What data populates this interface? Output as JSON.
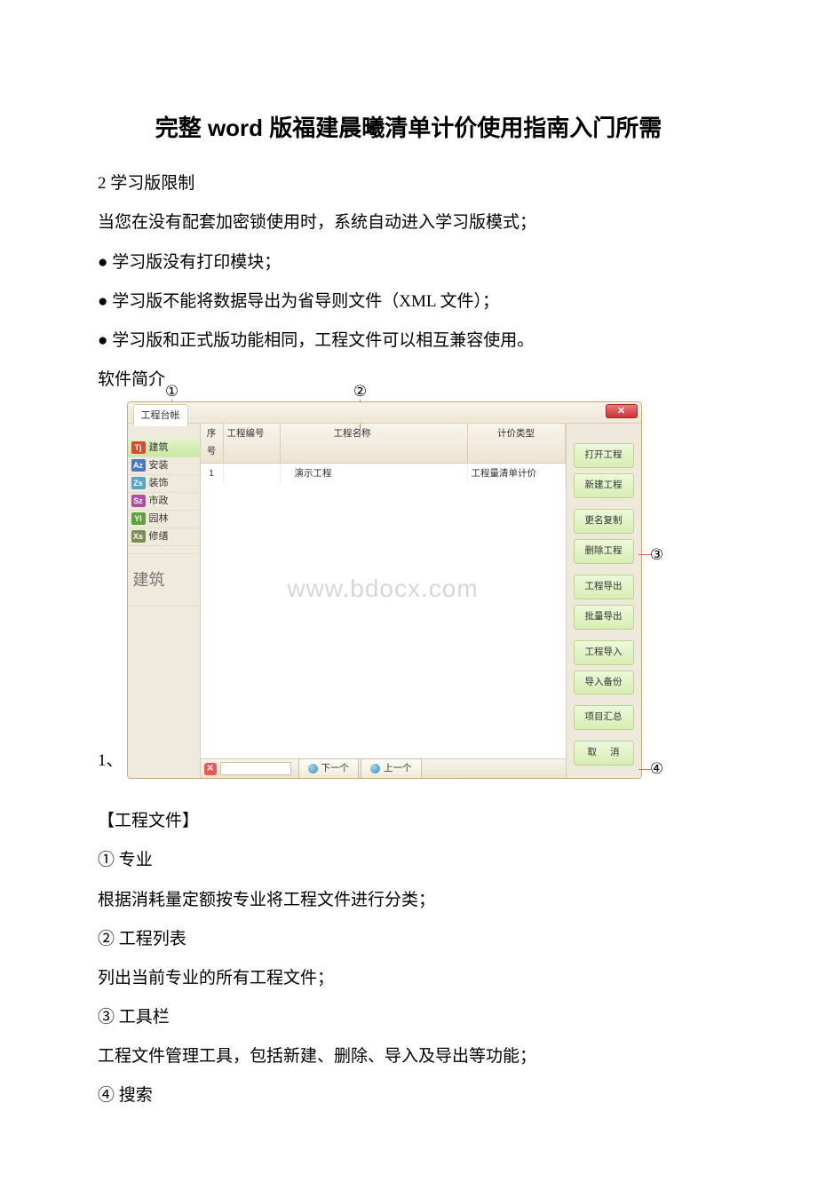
{
  "title": "完整 word 版福建晨曦清单计价使用指南入门所需",
  "paras": {
    "p1": "2 学习版限制",
    "p2": "当您在没有配套加密锁使用时，系统自动进入学习版模式；",
    "p3": "● 学习版没有打印模块；",
    "p4": "● 学习版不能将数据导出为省导则文件（XML 文件）；",
    "p5": "● 学习版和正式版功能相同，工程文件可以相互兼容使用。",
    "p6": "软件简介"
  },
  "markers": {
    "m1": "①",
    "m2": "②",
    "m3": "③",
    "m4": "④"
  },
  "figure_index": "1、",
  "window": {
    "tab_title": "工程台帐",
    "close_glyph": "✕",
    "sidebar": {
      "items": [
        {
          "code": "Tj",
          "color": "#d84b2e",
          "label": "建筑",
          "active": true
        },
        {
          "code": "Az",
          "color": "#4a77c4",
          "label": "安装",
          "active": false
        },
        {
          "code": "Zs",
          "color": "#5aa3c4",
          "label": "装饰",
          "active": false
        },
        {
          "code": "Sz",
          "color": "#b04fa0",
          "label": "市政",
          "active": false
        },
        {
          "code": "Yl",
          "color": "#5aa63a",
          "label": "园林",
          "active": false
        },
        {
          "code": "Xs",
          "color": "#7d8f57",
          "label": "修缮",
          "active": false
        }
      ],
      "big_label": "建筑"
    },
    "grid": {
      "headers": {
        "seq": "序号",
        "num": "工程编号",
        "name": "工程名称",
        "type": "计价类型"
      },
      "row": {
        "seq": "1",
        "num": "",
        "name": "演示工程",
        "type": "工程量清单计价"
      }
    },
    "watermark": "www.bdocx.com",
    "footer": {
      "delete_glyph": "✕",
      "next": "下一个",
      "prev": "上一个"
    },
    "toolbar": {
      "b1": "打开工程",
      "b2": "新建工程",
      "b3": "更名复制",
      "b4": "删除工程",
      "b5": "工程导出",
      "b6": "批量导出",
      "b7": "工程导入",
      "b8": "导入备份",
      "b9": "项目汇总",
      "b10": "取 消"
    }
  },
  "after": {
    "a1": "【工程文件】",
    "a2": "① 专业",
    "a3": "根据消耗量定额按专业将工程文件进行分类；",
    "a4": "② 工程列表",
    "a5": "列出当前专业的所有工程文件；",
    "a6": "③ 工具栏",
    "a7": "工程文件管理工具，包括新建、删除、导入及导出等功能；",
    "a8": "④ 搜索"
  }
}
